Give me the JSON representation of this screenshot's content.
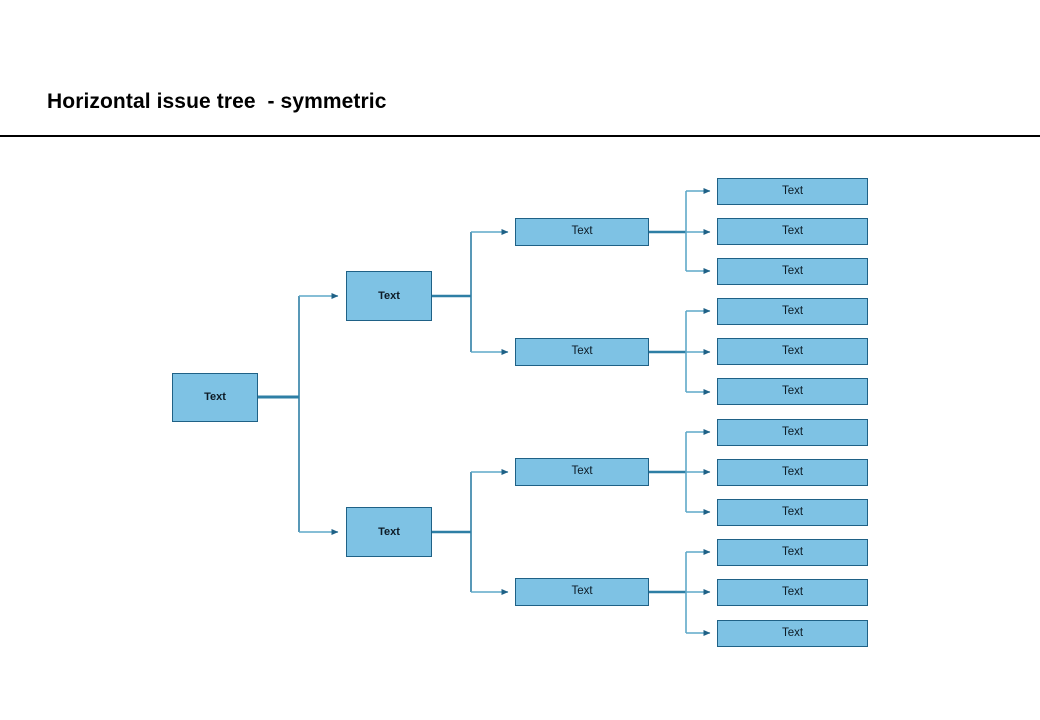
{
  "slide": {
    "title": "Horizontal issue tree  - symmetric",
    "background_color": "#ffffff",
    "rule_color": "#000000"
  },
  "theme": {
    "node_fill": "#7EC2E4",
    "node_border": "#1F6186",
    "connector_stub_color": "#2E7FA5",
    "connector_branch_color": "#5FA8C8",
    "arrow_color": "#1F6186",
    "text_color": "#0d1b26"
  },
  "diagram": {
    "type": "horizontal-issue-tree",
    "levels": 4,
    "nodes": {
      "root": {
        "label": "Text"
      },
      "level2": [
        {
          "label": "Text"
        },
        {
          "label": "Text"
        }
      ],
      "level3": [
        {
          "label": "Text"
        },
        {
          "label": "Text"
        },
        {
          "label": "Text"
        },
        {
          "label": "Text"
        }
      ],
      "level4": [
        {
          "label": "Text"
        },
        {
          "label": "Text"
        },
        {
          "label": "Text"
        },
        {
          "label": "Text"
        },
        {
          "label": "Text"
        },
        {
          "label": "Text"
        },
        {
          "label": "Text"
        },
        {
          "label": "Text"
        },
        {
          "label": "Text"
        },
        {
          "label": "Text"
        },
        {
          "label": "Text"
        },
        {
          "label": "Text"
        }
      ]
    }
  }
}
